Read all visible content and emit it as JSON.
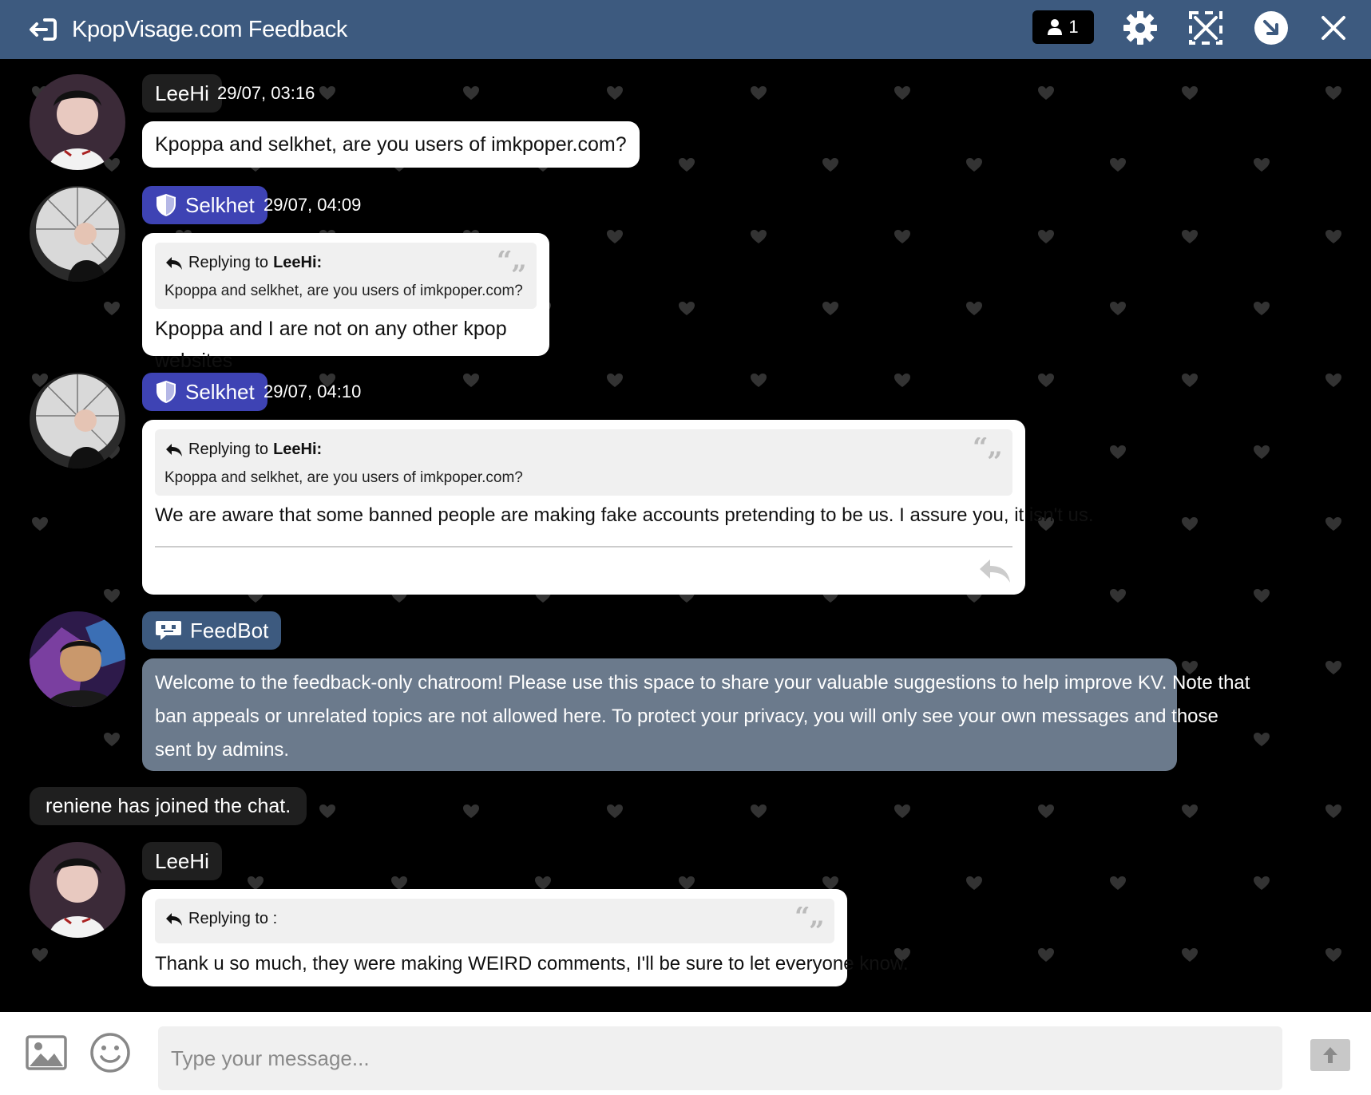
{
  "header": {
    "title": "KpopVisage.com Feedback",
    "users_count": "1",
    "icons": [
      "exit-icon",
      "user-icon",
      "gear-icon",
      "expand-icon",
      "minimize-icon",
      "close-icon"
    ],
    "color": "#3d5a7f"
  },
  "messages": [
    {
      "user": "LeeHi",
      "time": "29/07, 03:16",
      "text": "Kpoppa and selkhet, are you users of imkpoper.com?"
    },
    {
      "user": "Selkhet",
      "role": "admin",
      "time": "29/07, 04:09",
      "reply": {
        "prefix": "Replying to",
        "to": "LeeHi:",
        "quoted": "Kpoppa and selkhet, are you users of imkpoper.com?"
      },
      "text": "Kpoppa and I are not on any other kpop websites"
    },
    {
      "user": "Selkhet",
      "role": "admin",
      "time": "29/07, 04:10",
      "reply": {
        "prefix": "Replying to",
        "to": "LeeHi:",
        "quoted": "Kpoppa and selkhet, are you users of imkpoper.com?"
      },
      "text": "We are aware that some banned people are making fake accounts pretending to be us. I assure you, it isn't us."
    },
    {
      "user": "FeedBot",
      "role": "bot",
      "lines": [
        "Welcome to the feedback-only chatroom! Please use this space to share your valuable suggestions to help improve KV. Note that",
        "ban appeals or unrelated topics are not allowed here. To protect your privacy, you will only see your own messages and those",
        "sent by admins."
      ]
    },
    {
      "system": "reniene has joined the chat."
    },
    {
      "user": "LeeHi",
      "reply": {
        "prefix": "Replying to :"
      },
      "text": "Thank u so much, they were making WEIRD comments, I'll be sure to let everyone know."
    }
  ],
  "composer": {
    "placeholder": "Type your message...",
    "icons": [
      "image-icon",
      "emoji-icon",
      "send-icon"
    ]
  },
  "colors": {
    "admin": "#3e43b4",
    "bot_bubble": "#6b7a8c",
    "background": "#000000"
  }
}
